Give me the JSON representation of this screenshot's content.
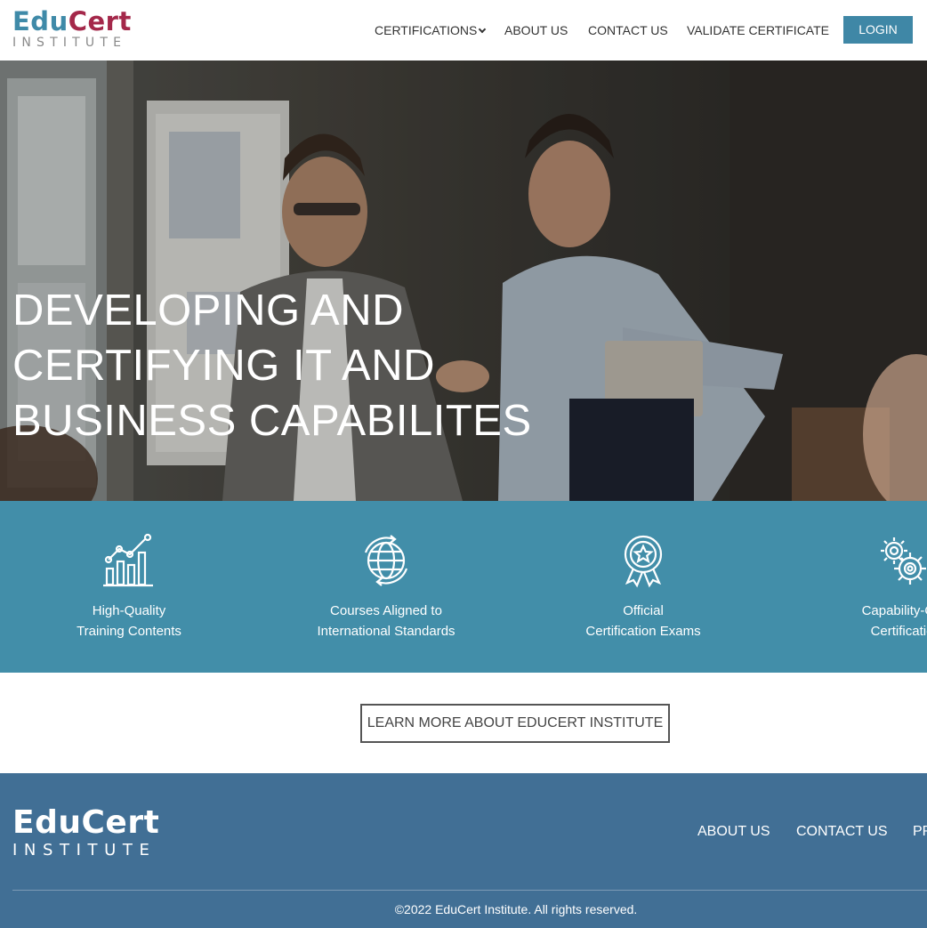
{
  "header": {
    "logo": {
      "part1": "Edu",
      "part2": "Cert",
      "sub": "INSTITUTE"
    },
    "nav": {
      "certifications": "CERTIFICATIONS",
      "about": "ABOUT US",
      "contact": "CONTACT US",
      "validate": "VALIDATE CERTIFICATE"
    },
    "login": "LOGIN"
  },
  "hero": {
    "title_lines": [
      "DEVELOPING AND",
      "CERTIFYING IT AND",
      "BUSINESS CAPABILITES"
    ]
  },
  "features": [
    {
      "icon": "chart-growth-icon",
      "line1": "High-Quality",
      "line2": "Training Contents"
    },
    {
      "icon": "globe-icon",
      "line1": "Courses Aligned to",
      "line2": "International Standards"
    },
    {
      "icon": "award-badge-icon",
      "line1": "Official",
      "line2": "Certification Exams"
    },
    {
      "icon": "gears-icon",
      "line1": "Capability-Ori",
      "line2": "Certificatio"
    }
  ],
  "learn_more": "LEARN MORE ABOUT EDUCERT INSTITUTE",
  "footer": {
    "logo": {
      "main": "EduCert",
      "sub": "INSTITUTE"
    },
    "links": {
      "about": "ABOUT US",
      "contact": "CONTACT US",
      "privacy": "PR"
    },
    "copyright": "©2022 EduCert Institute. All rights reserved."
  },
  "colors": {
    "brand_teal": "#3f8aa8",
    "brand_crimson": "#a4284a",
    "features_band": "#428ea9",
    "footer_bg": "#416f95",
    "login_button": "#3f87a6"
  }
}
